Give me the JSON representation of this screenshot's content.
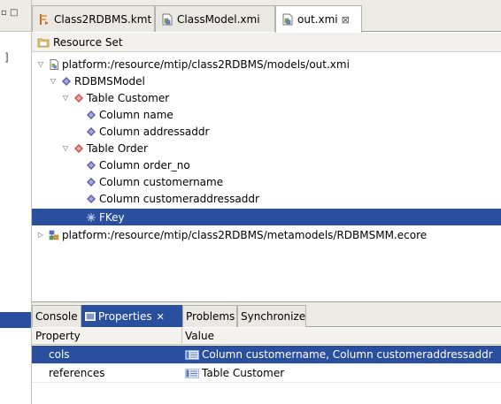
{
  "left_panel": {
    "controls": "▫ □",
    "bracket": "]"
  },
  "editor_tabs": [
    {
      "label": "Class2RDBMS.kmt",
      "icon": "transform-file-icon",
      "active": false
    },
    {
      "label": "ClassModel.xmi",
      "icon": "xmi-file-icon",
      "active": false
    },
    {
      "label": "out.xmi",
      "icon": "xmi-file-icon",
      "active": true,
      "close": "⊠"
    }
  ],
  "resource_set": {
    "label": "Resource Set",
    "icon": "resource-set-icon"
  },
  "tree": {
    "root_uri": "platform:/resource/mtip/class2RDBMS/models/out.xmi",
    "model": "RDBMSModel",
    "table_customer": "Table Customer",
    "col_name": "Column name",
    "col_addressaddr": "Column addressaddr",
    "table_order": "Table Order",
    "col_order_no": "Column order_no",
    "col_customername": "Column customername",
    "col_customeraddressaddr": "Column customeraddressaddr",
    "fkey": "FKey",
    "metamodel_uri": "platform:/resource/mtip/class2RDBMS/metamodels/RDBMSMM.ecore",
    "twisty_expanded": "▽",
    "twisty_collapsed": "▷"
  },
  "bottom_tabs": [
    {
      "label": "Console",
      "active": false
    },
    {
      "label": "Properties",
      "active": true,
      "close": "✕"
    },
    {
      "label": "Problems",
      "active": false
    },
    {
      "label": "Synchronize",
      "active": false
    }
  ],
  "properties": {
    "header_property": "Property",
    "header_value": "Value",
    "rows": [
      {
        "name": "cols",
        "value": "Column customername, Column customeraddressaddr",
        "selected": true
      },
      {
        "name": "references",
        "value": "Table Customer",
        "selected": false
      }
    ]
  },
  "colors": {
    "selection": "#2a4f9e",
    "tab_bar": "#ecebe6",
    "class_icon": "#5c5ca8",
    "table_icon": "#c0504d"
  }
}
